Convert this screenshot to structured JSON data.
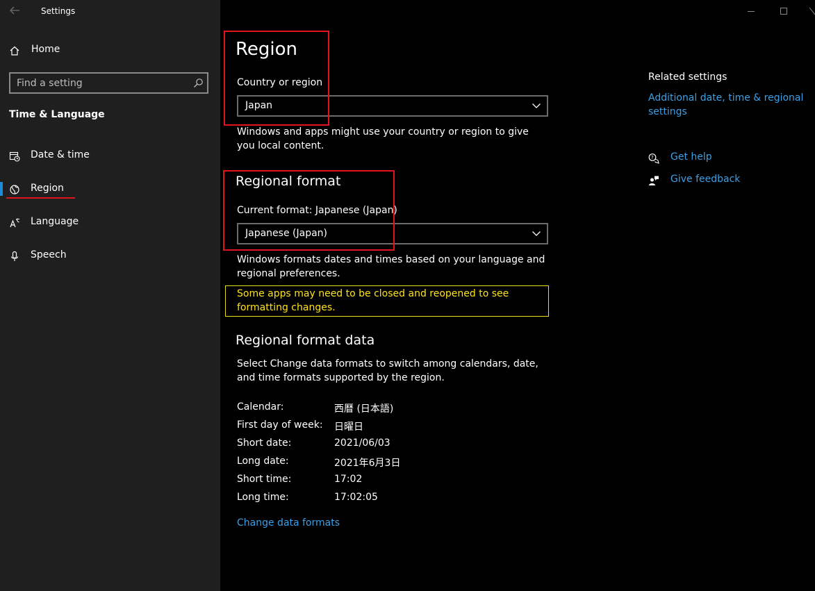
{
  "window": {
    "title": "Settings"
  },
  "sidebar": {
    "home_label": "Home",
    "search_placeholder": "Find a setting",
    "section_title": "Time & Language",
    "items": [
      {
        "label": "Date & time",
        "icon": "calendar-clock-icon"
      },
      {
        "label": "Region",
        "icon": "globe-icon",
        "active": true
      },
      {
        "label": "Language",
        "icon": "language-icon"
      },
      {
        "label": "Speech",
        "icon": "microphone-icon"
      }
    ]
  },
  "region": {
    "title": "Region",
    "country_label": "Country or region",
    "country_value": "Japan",
    "country_description": "Windows and apps might use your country or region to give you local content."
  },
  "regional_format": {
    "title": "Regional format",
    "current_format_label": "Current format: Japanese (Japan)",
    "format_value": "Japanese (Japan)",
    "description": "Windows formats dates and times based on your language and regional preferences.",
    "warning": "Some apps may need to be closed and reopened to see formatting changes."
  },
  "regional_format_data": {
    "title": "Regional format data",
    "description": "Select Change data formats to switch among calendars, date, and time formats supported by the region.",
    "rows": [
      {
        "key": "Calendar:",
        "value": "西暦 (日本語)"
      },
      {
        "key": "First day of week:",
        "value": "日曜日"
      },
      {
        "key": "Short date:",
        "value": "2021/06/03"
      },
      {
        "key": "Long date:",
        "value": "2021年6月3日"
      },
      {
        "key": "Short time:",
        "value": "17:02"
      },
      {
        "key": "Long time:",
        "value": "17:02:05"
      }
    ],
    "change_link": "Change data formats"
  },
  "related": {
    "title": "Related settings",
    "link": "Additional date, time & regional settings",
    "get_help": "Get help",
    "give_feedback": "Give feedback"
  },
  "colors": {
    "accent": "#3ca0e6",
    "highlight_red": "#e3131c",
    "warning_yellow": "#ffe21a",
    "sidebar_bg": "#1f1f1f",
    "content_bg": "#000000"
  }
}
